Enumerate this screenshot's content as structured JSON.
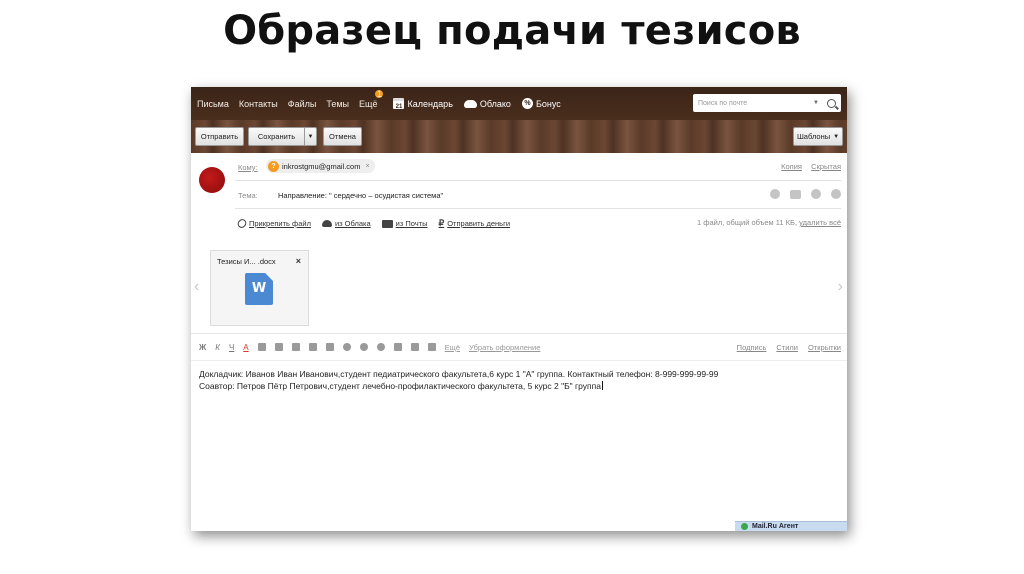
{
  "slide": {
    "title": "Образец подачи тезисов"
  },
  "nav": {
    "items": [
      "Письма",
      "Контакты",
      "Файлы",
      "Темы"
    ],
    "more_label": "Ещё",
    "more_badge": "1",
    "apps": {
      "calendar": "Календарь",
      "calendar_day": "21",
      "cloud": "Облако",
      "bonus": "Бонус"
    },
    "search_placeholder": "Поиск по почте"
  },
  "toolbar": {
    "send": "Отправить",
    "save": "Сохранить",
    "cancel": "Отмена",
    "templates": "Шаблоны"
  },
  "compose": {
    "to_label": "Кому:",
    "recipient": "inkrostgmu@gmail.com",
    "cc": "Копия",
    "hidden": "Скрытая",
    "subject_label": "Тема:",
    "subject": "Направление: \" сердечно – осудистая система\"",
    "attach_file": "Прикрепить файл",
    "from_cloud": "из Облака",
    "from_mail": "из Почты",
    "send_money": "Отправить деньги",
    "file_info": "1 файл, общий объем 11 КБ,",
    "delete_all": "удалить всё",
    "attachment_name": "Тезисы И... .docx",
    "attachment_icon_letter": "W"
  },
  "format": {
    "bold": "Ж",
    "italic": "К",
    "underline": "Ч",
    "color": "А",
    "more": "Ещё",
    "clear": "Убрать оформление",
    "signature": "Подпись",
    "styles": "Стили",
    "postcards": "Открытки"
  },
  "body": {
    "line1": "Докладчик: Иванов Иван Иванович,студент педиатрического факультета,6 курс 1 \"А\" группа. Контактный телефон: 8-999-999-99-99",
    "line2": "Соавтор: Петров Пётр Петрович,студент лечебно-профилактического факультета, 5 курс 2 \"Б\" группа"
  },
  "agent": {
    "label": "Mail.Ru Агент"
  }
}
